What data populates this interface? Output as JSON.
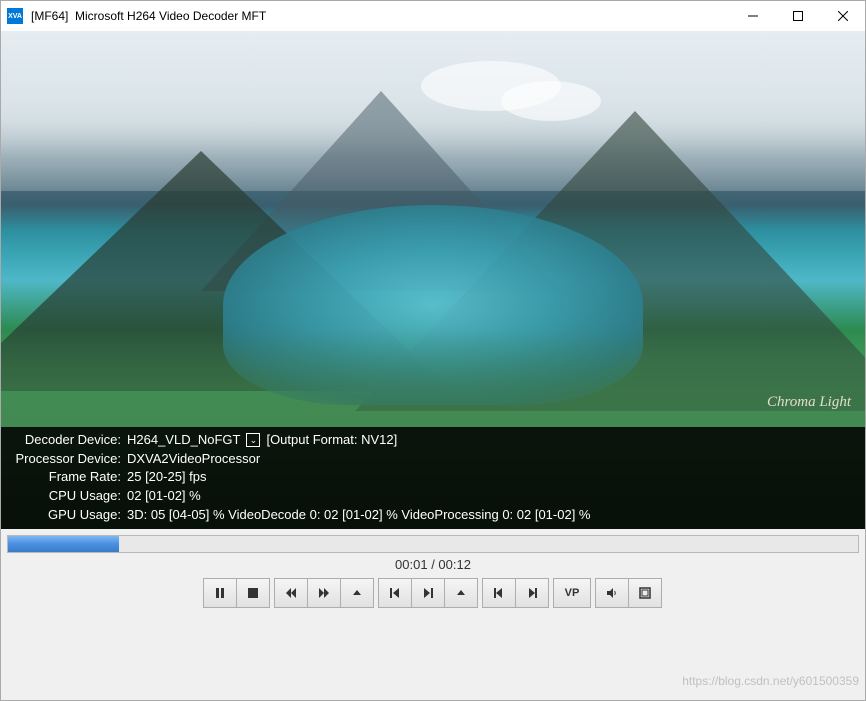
{
  "window": {
    "app_icon_text": "XVA",
    "prefix": "[MF64]",
    "title": "Microsoft H264 Video Decoder MFT"
  },
  "video_watermark": "Chroma Light",
  "overlay": {
    "rows": [
      {
        "label": "Decoder Device:",
        "value": "H264_VLD_NoFGT",
        "dropdown": true,
        "suffix": "[Output Format: NV12]"
      },
      {
        "label": "Processor Device:",
        "value": "DXVA2VideoProcessor"
      },
      {
        "label": "Frame Rate:",
        "value": "25 [20-25] fps"
      },
      {
        "label": "CPU Usage:",
        "value": "02 [01-02] %"
      },
      {
        "label": "GPU Usage:",
        "value": "3D: 05 [04-05] %  VideoDecode 0: 02 [01-02] %  VideoProcessing 0: 02 [01-02] %"
      }
    ]
  },
  "playback": {
    "current": "00:01",
    "total": "00:12",
    "separator": " / ",
    "progress_pct": 13
  },
  "buttons": {
    "vp_label": "VP"
  },
  "footer_url": "https://blog.csdn.net/y601500359"
}
